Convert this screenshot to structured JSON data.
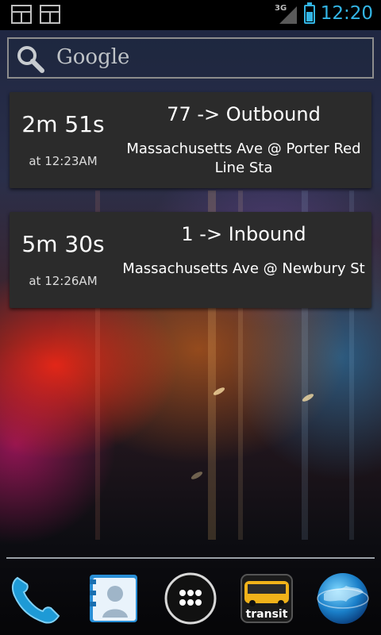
{
  "status_bar": {
    "network_type": "3G",
    "time": "12:20",
    "icons": [
      "notification-icon",
      "notification-icon",
      "signal-icon",
      "battery-charging-icon"
    ],
    "accent_color": "#33b5e5"
  },
  "search_widget": {
    "label": "Google",
    "icon": "search-icon"
  },
  "arrivals": [
    {
      "eta": "2m 51s",
      "at_time": "at 12:23AM",
      "route": "77 -> Outbound",
      "stop": "Massachusetts Ave @ Porter Red Line Sta"
    },
    {
      "eta": "5m 30s",
      "at_time": "at 12:26AM",
      "route": "1 -> Inbound",
      "stop": "Massachusetts Ave @ Newbury St"
    }
  ],
  "dock": {
    "items": [
      {
        "icon": "phone-icon"
      },
      {
        "icon": "contacts-icon"
      },
      {
        "icon": "app-drawer-icon"
      },
      {
        "icon": "transit-icon",
        "label": "transit"
      },
      {
        "icon": "browser-globe-icon"
      }
    ]
  }
}
